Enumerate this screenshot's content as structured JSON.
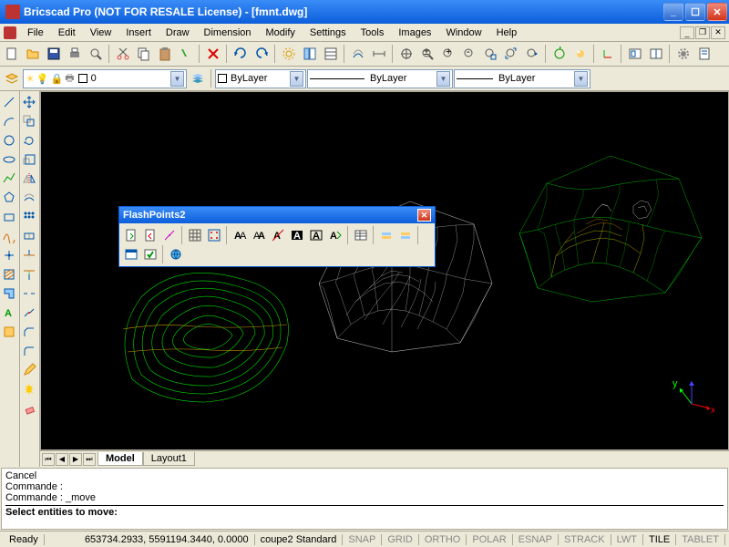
{
  "title": "Bricscad Pro (NOT FOR RESALE License) - [fmnt.dwg]",
  "menu": [
    "File",
    "Edit",
    "View",
    "Insert",
    "Draw",
    "Dimension",
    "Modify",
    "Settings",
    "Tools",
    "Images",
    "Window",
    "Help"
  ],
  "layer_combo": "0",
  "prop_color": "ByLayer",
  "prop_linetype": "ByLayer",
  "prop_lineweight": "ByLayer",
  "floating": {
    "title": "FlashPoints2"
  },
  "tabs": {
    "active": "Model",
    "layout": "Layout1"
  },
  "cmd": {
    "l1": "Cancel",
    "l2": "Commande :",
    "l3": "Commande : _move",
    "prompt": "Select entities to move:"
  },
  "status": {
    "ready": "Ready",
    "coords": "653734.2933, 5591194.3440, 0.0000",
    "style": "coupe2 Standard",
    "modes": [
      "SNAP",
      "GRID",
      "ORTHO",
      "POLAR",
      "ESNAP",
      "STRACK",
      "LWT",
      "TILE",
      "TABLET"
    ]
  },
  "ucs": {
    "x": "x",
    "y": "y"
  }
}
